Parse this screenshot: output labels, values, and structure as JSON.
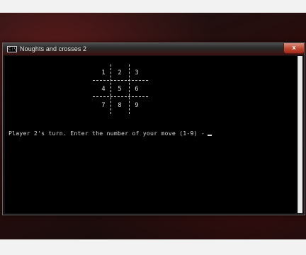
{
  "window": {
    "title": "Noughts and crosses 2",
    "close_label": "x",
    "icon_text": "C:\\"
  },
  "board": {
    "cells": [
      "1",
      "2",
      "3",
      "4",
      "5",
      "6",
      "7",
      "8",
      "9"
    ]
  },
  "console": {
    "prompt": "Player 2's turn. Enter the number of your move (1-9) -"
  }
}
